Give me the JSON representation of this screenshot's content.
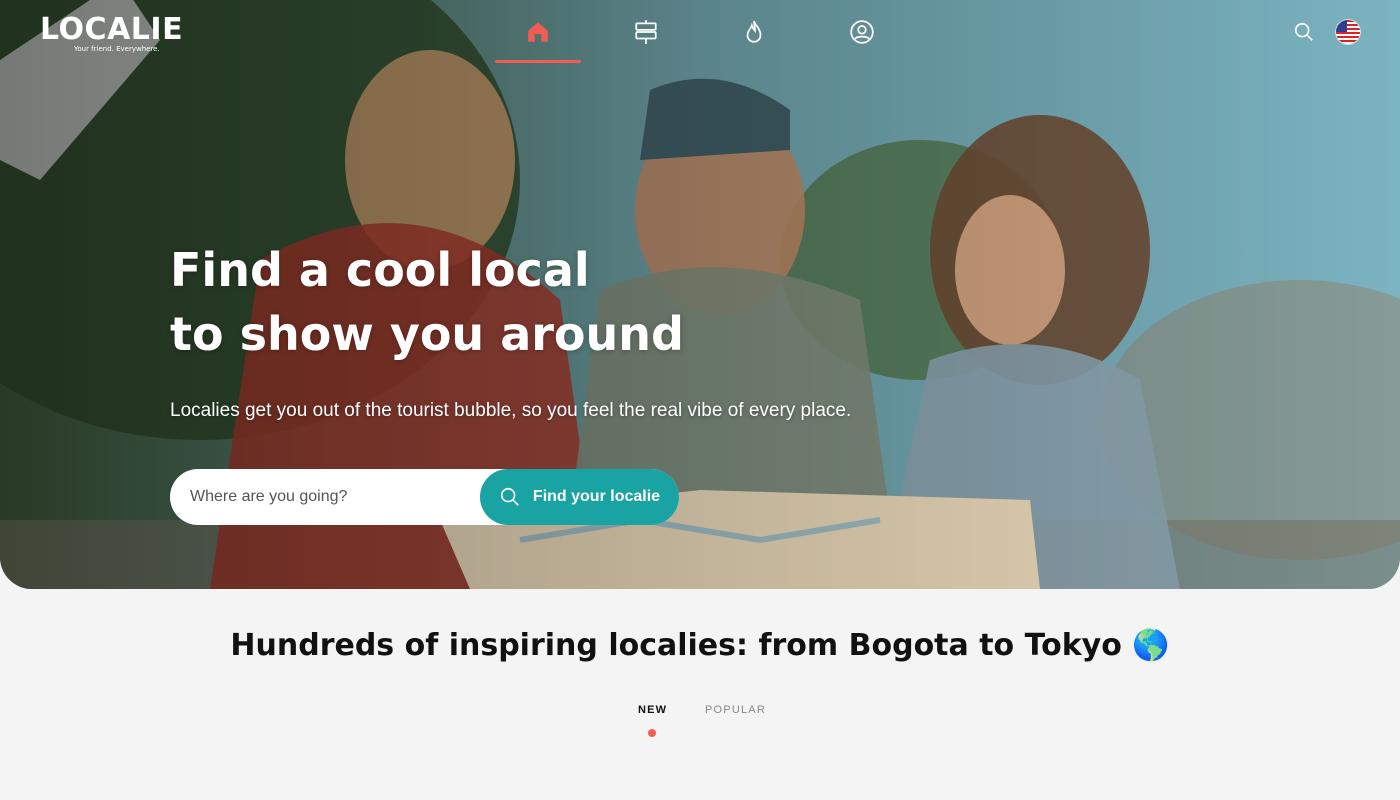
{
  "brand": {
    "name": "LOCALIE",
    "tagline": "Your friend. Everywhere."
  },
  "nav": {
    "items": [
      {
        "icon": "home-icon",
        "active": true
      },
      {
        "icon": "signpost-icon",
        "active": false
      },
      {
        "icon": "flame-icon",
        "active": false
      },
      {
        "icon": "user-circle-icon",
        "active": false
      }
    ],
    "right": [
      {
        "icon": "search-icon"
      },
      {
        "icon": "us-flag-icon",
        "label": "Language"
      }
    ]
  },
  "hero": {
    "headline_line1": "Find a cool local",
    "headline_line2": "to show you around",
    "subheadline": "Localies get you out of the tourist bubble, so you feel the real vibe of every place.",
    "search_placeholder": "Where are you going?",
    "search_button": "Find your localie"
  },
  "section": {
    "title": "Hundreds of inspiring localies: from Bogota to Tokyo 🌎",
    "tabs": [
      {
        "label": "NEW",
        "active": true
      },
      {
        "label": "POPULAR",
        "active": false
      }
    ]
  },
  "colors": {
    "accent": "#f25c54",
    "button": "#1aa3a3"
  }
}
